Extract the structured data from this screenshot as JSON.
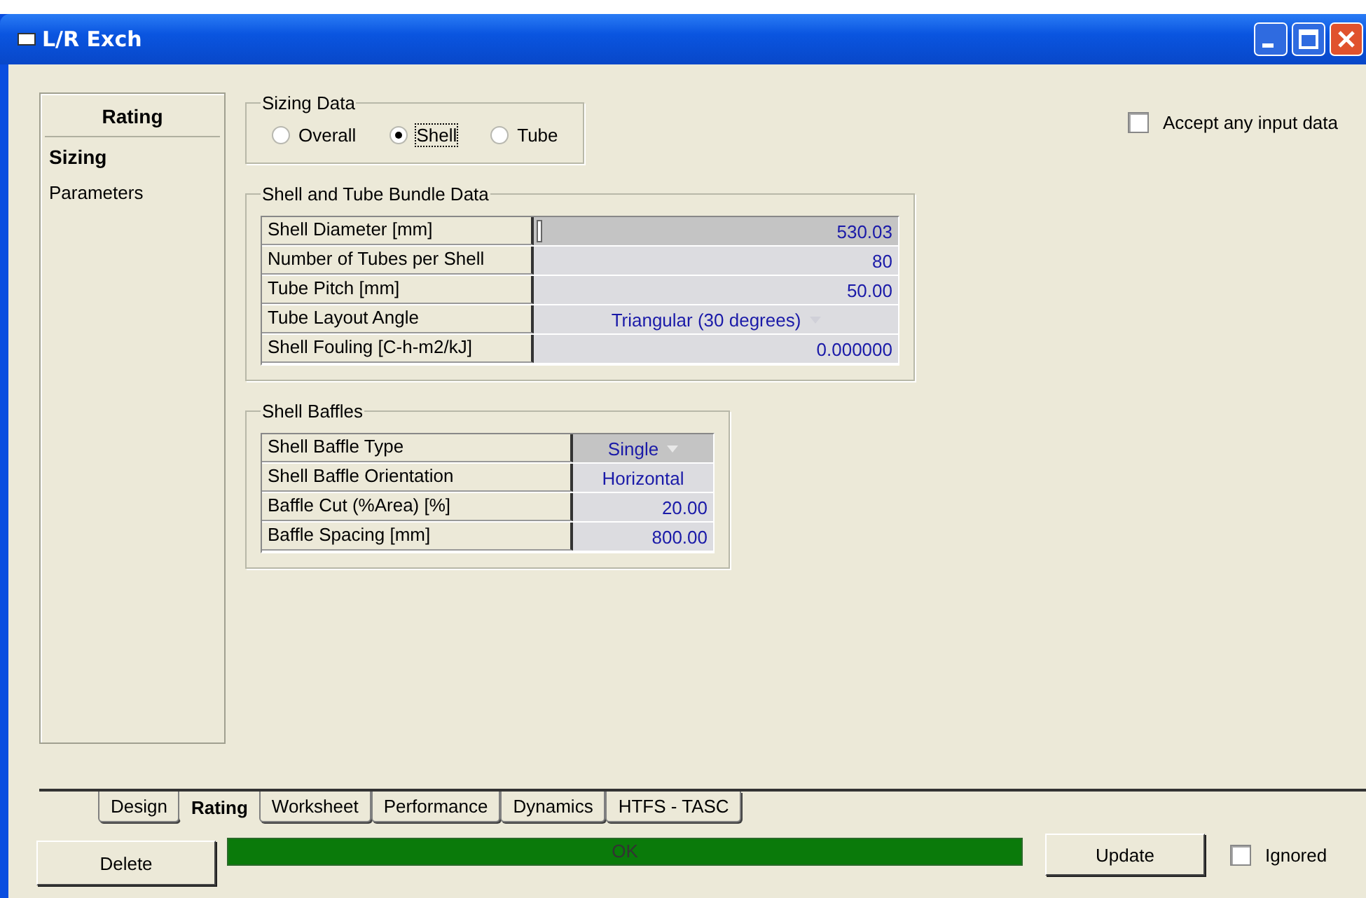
{
  "window": {
    "title": "L/R Exch"
  },
  "sidebar": {
    "heading": "Rating",
    "items": [
      {
        "label": "Sizing",
        "selected": true
      },
      {
        "label": "Parameters",
        "selected": false
      }
    ]
  },
  "sizing_data": {
    "title": "Sizing Data",
    "options": [
      {
        "label": "Overall",
        "selected": false
      },
      {
        "label": "Shell",
        "selected": true
      },
      {
        "label": "Tube",
        "selected": false
      }
    ]
  },
  "accept_any_input": {
    "label": "Accept any input data",
    "checked": false
  },
  "bundle": {
    "title": "Shell and Tube Bundle Data",
    "rows": [
      {
        "label": "Shell Diameter [mm]",
        "value": "530.03",
        "kind": "number",
        "selected": true
      },
      {
        "label": "Number of Tubes per Shell",
        "value": "80",
        "kind": "number",
        "selected": false
      },
      {
        "label": "Tube Pitch [mm]",
        "value": "50.00",
        "kind": "number",
        "selected": false
      },
      {
        "label": "Tube Layout Angle",
        "value": "Triangular (30 degrees)",
        "kind": "dropdown",
        "selected": false
      },
      {
        "label": "Shell Fouling [C-h-m2/kJ]",
        "value": "0.000000",
        "kind": "number",
        "selected": false
      }
    ]
  },
  "baffles": {
    "title": "Shell Baffles",
    "rows": [
      {
        "label": "Shell Baffle Type",
        "value": "Single",
        "kind": "dropdown",
        "selected": true
      },
      {
        "label": "Shell Baffle Orientation",
        "value": "Horizontal",
        "kind": "choice",
        "selected": false
      },
      {
        "label": "Baffle Cut (%Area) [%]",
        "value": "20.00",
        "kind": "number",
        "selected": false
      },
      {
        "label": "Baffle Spacing [mm]",
        "value": "800.00",
        "kind": "number",
        "selected": false
      }
    ]
  },
  "tabs": [
    {
      "label": "Design",
      "selected": false
    },
    {
      "label": "Rating",
      "selected": true
    },
    {
      "label": "Worksheet",
      "selected": false
    },
    {
      "label": "Performance",
      "selected": false
    },
    {
      "label": "Dynamics",
      "selected": false
    },
    {
      "label": "HTFS - TASC",
      "selected": false
    }
  ],
  "buttons": {
    "delete": "Delete",
    "update": "Update"
  },
  "status": {
    "text": "OK"
  },
  "ignored": {
    "label": "Ignored",
    "checked": false
  }
}
